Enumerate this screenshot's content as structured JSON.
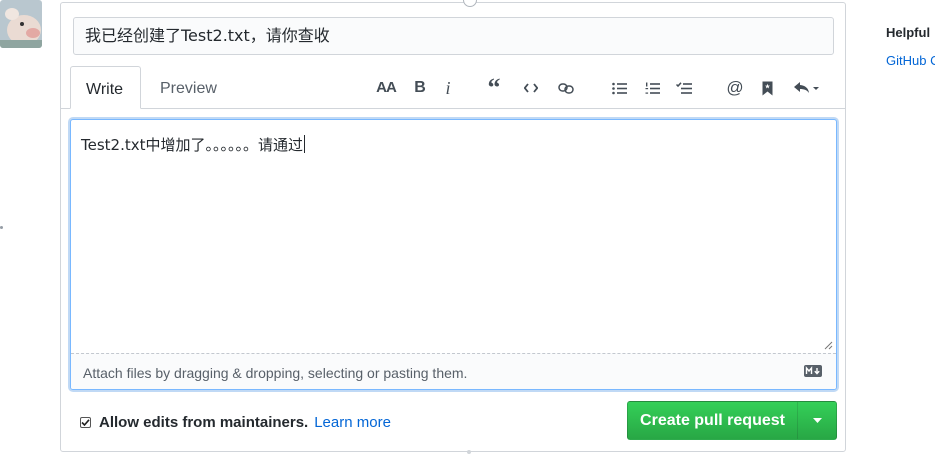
{
  "title_input": {
    "value": "我已经创建了Test2.txt，请你查收"
  },
  "tabs": [
    {
      "label": "Write",
      "active": true
    },
    {
      "label": "Preview",
      "active": false
    }
  ],
  "toolbar": {
    "heading_label": "AA",
    "bold_label": "B",
    "italic_label": "i",
    "quote_label": "“"
  },
  "editor": {
    "body_text": "Test2.txt中增加了。。。。。。请通过",
    "attach_hint": "Attach files by dragging & dropping, selecting or pasting them."
  },
  "footer": {
    "allow_edits_label": "Allow edits from maintainers.",
    "allow_edits_checked": true,
    "learn_more_label": "Learn more",
    "create_pr_label": "Create pull request"
  },
  "sidebar": {
    "helpful_label": "Helpful",
    "github_link_label": "GitHub C"
  },
  "colors": {
    "primary_button": "#28a745",
    "link": "#0366d6",
    "focus_border": "#79b8ff"
  },
  "icons": [
    "heading-icon",
    "bold-icon",
    "italic-icon",
    "quote-icon",
    "code-icon",
    "link-icon",
    "bullet-list-icon",
    "numbered-list-icon",
    "task-list-icon",
    "mention-icon",
    "bookmark-icon",
    "reply-icon",
    "markdown-icon",
    "caret-down-icon"
  ]
}
